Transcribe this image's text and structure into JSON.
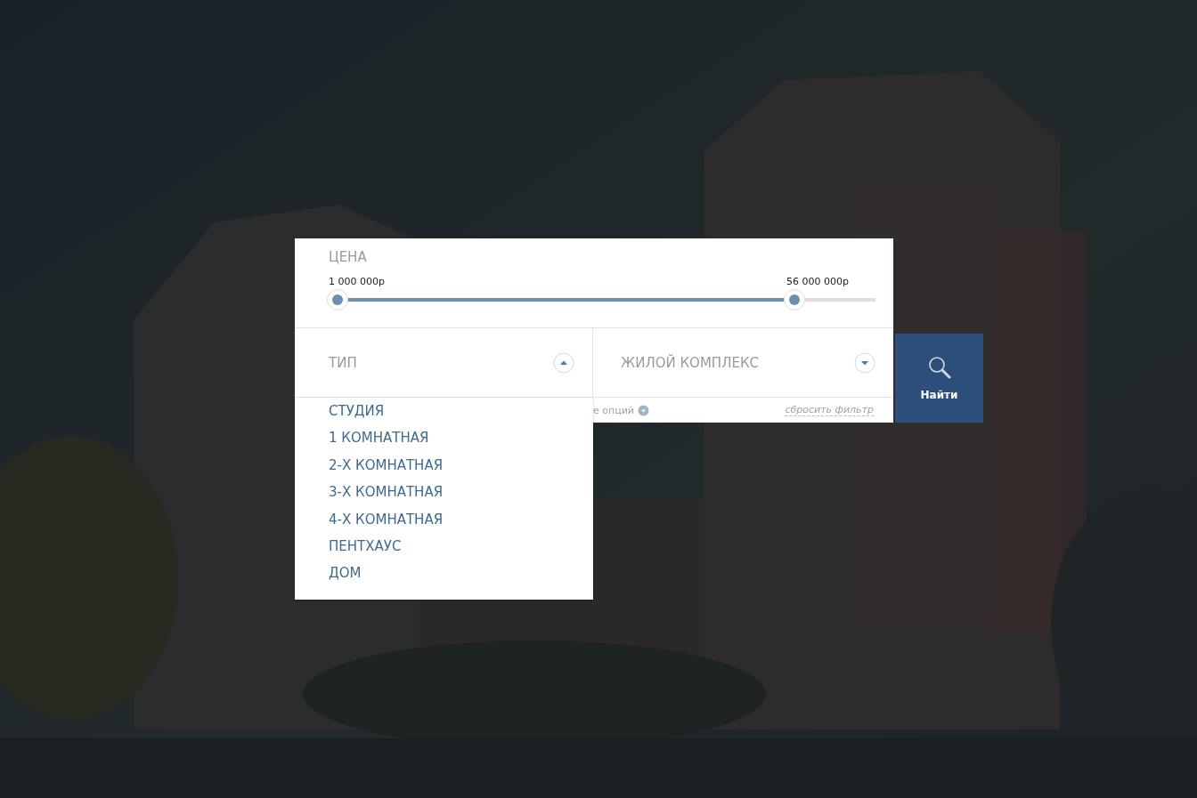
{
  "price": {
    "label": "ЦЕНА",
    "min": {
      "text": "1 000 000р",
      "level": 0
    },
    "max": {
      "text": "56 000 000р",
      "level": 0.85
    }
  },
  "type_filter": {
    "label": "ТИП",
    "expanded": true,
    "options": [
      {
        "label": "СТУДИЯ"
      },
      {
        "label": "1 КОМНАТНАЯ"
      },
      {
        "label": "2-Х КОМНАТНАЯ"
      },
      {
        "label": "3-Х КОМНАТНАЯ"
      },
      {
        "label": "4-Х КОМНАТНАЯ"
      },
      {
        "label": "ПЕНТХАУС"
      },
      {
        "label": "ДОМ"
      }
    ]
  },
  "complex_filter": {
    "label": "ЖИЛОЙ КОМПЛЕКС",
    "expanded": false
  },
  "more_options": {
    "text": "е опций"
  },
  "reset": {
    "text": "сбросить фильтр"
  },
  "search_button": {
    "label": "Найти"
  }
}
